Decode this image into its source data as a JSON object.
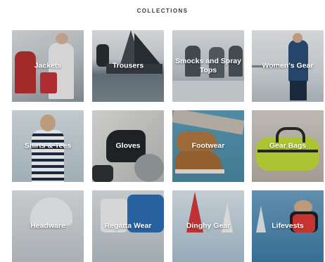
{
  "section": {
    "heading": "COLLECTIONS"
  },
  "collections": [
    {
      "label": "Jackets"
    },
    {
      "label": "Trousers"
    },
    {
      "label": "Smocks and Spray Tops"
    },
    {
      "label": "Women's Gear"
    },
    {
      "label": "Shirts & Tees"
    },
    {
      "label": "Gloves"
    },
    {
      "label": "Footwear"
    },
    {
      "label": "Gear Bags"
    },
    {
      "label": "Headware"
    },
    {
      "label": "Regatta Wear"
    },
    {
      "label": "Dinghy Gear"
    },
    {
      "label": "Lifevests"
    }
  ]
}
